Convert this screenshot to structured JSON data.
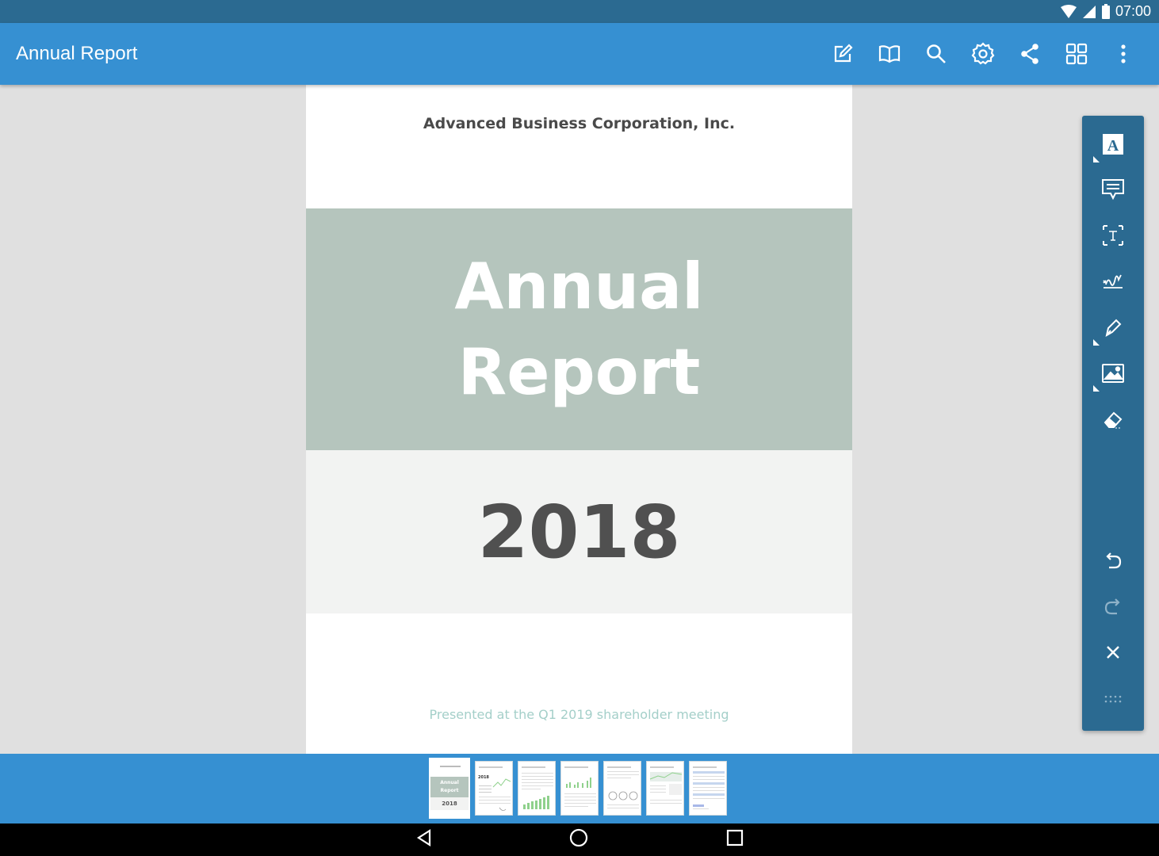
{
  "status_bar": {
    "time": "07:00"
  },
  "app_bar": {
    "title": "Annual Report",
    "actions": [
      "edit-icon",
      "book-icon",
      "search-icon",
      "settings-icon",
      "share-icon",
      "grid-icon",
      "more-vert-icon"
    ]
  },
  "document": {
    "company": "Advanced Business Corporation, Inc.",
    "title_line1": "Annual",
    "title_line2": "Report",
    "year": "2018",
    "presented": "Presented at the Q1 2019 shareholder meeting"
  },
  "annotation_toolbar": {
    "tools": [
      "text-annotation-icon",
      "comment-icon",
      "text-box-icon",
      "signature-icon",
      "pen-icon",
      "image-icon",
      "eraser-icon"
    ],
    "controls": [
      "undo-icon",
      "redo-icon",
      "close-icon",
      "drag-handle-icon"
    ]
  },
  "thumbnails": {
    "count": 7,
    "selected_index": 0,
    "first_thumb": {
      "title_line1": "Annual",
      "title_line2": "Report",
      "year": "2018"
    },
    "second_thumb": {
      "year": "2018"
    }
  },
  "colors": {
    "status_bar": "#2b6a91",
    "app_bar": "#3690d2",
    "title_band": "#b5c5bd",
    "year_band": "#f2f3f2",
    "presented_text": "#a4cfc9"
  }
}
